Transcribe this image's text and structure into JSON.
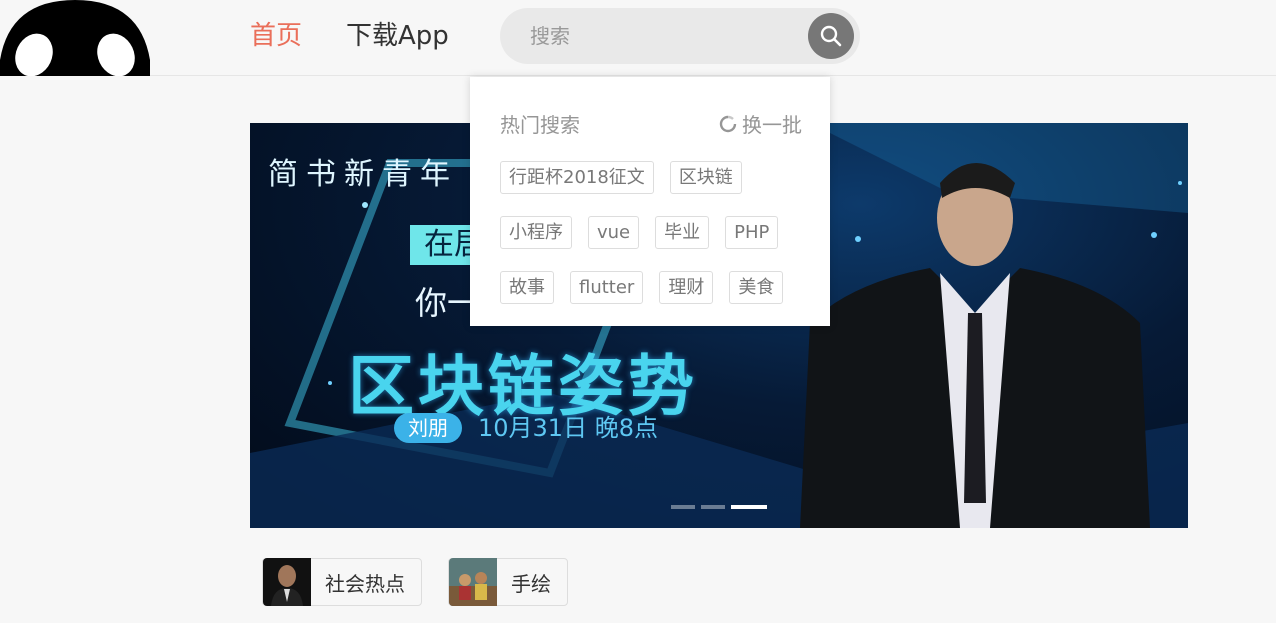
{
  "header": {
    "nav": [
      {
        "label": "首页"
      },
      {
        "label": "下载App"
      }
    ],
    "search": {
      "placeholder": "搜索"
    }
  },
  "banner": {
    "title_top": "简书新青年",
    "line1": "在居",
    "line2": "你一",
    "main_title": "区块链姿势",
    "speaker": "刘朋",
    "time": "10月31日 晚8点",
    "slides_total": 3,
    "active_slide": 3
  },
  "hot_search": {
    "title": "热门搜索",
    "refresh_label": "换一批",
    "rows": [
      [
        "行距杯2018征文",
        "区块链"
      ],
      [
        "小程序",
        "vue",
        "毕业",
        "PHP"
      ],
      [
        "故事",
        "flutter",
        "理财",
        "美食"
      ]
    ]
  },
  "topics": [
    {
      "label": "社会热点"
    },
    {
      "label": "手绘"
    }
  ],
  "colors": {
    "accent": "#ea6f5a",
    "search_button": "#777777",
    "background": "#f7f7f7"
  }
}
